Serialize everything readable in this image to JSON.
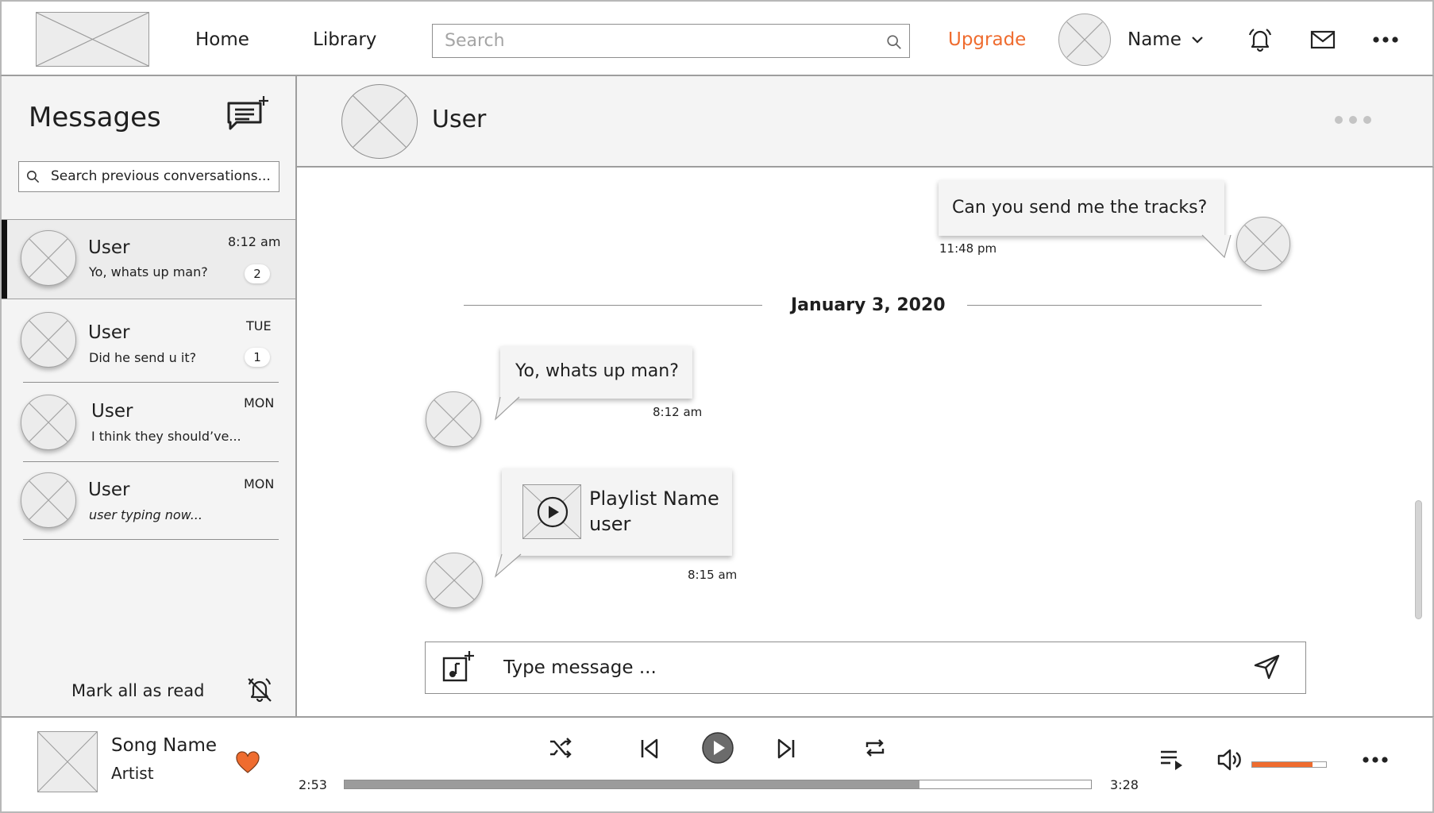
{
  "header": {
    "logo": "logo-placeholder",
    "nav": [
      {
        "label": "Home"
      },
      {
        "label": "Library"
      }
    ],
    "search": {
      "placeholder": "Search",
      "value": ""
    },
    "upgrade_label": "Upgrade",
    "user_name": "Name",
    "icons": [
      "search-icon",
      "chevron-down-icon",
      "bell-icon",
      "mail-icon",
      "more-icon"
    ]
  },
  "sidebar": {
    "title": "Messages",
    "search_placeholder": "Search previous conversations...",
    "conversations": [
      {
        "name": "User",
        "preview": "Yo, whats up man?",
        "time": "8:12 am",
        "badge": "2",
        "active": true
      },
      {
        "name": "User",
        "preview": "Did he send u it?",
        "time": "TUE",
        "badge": "1"
      },
      {
        "name": "User",
        "preview": "I think they should’ve...",
        "time": "MON"
      },
      {
        "name": "User",
        "preview": "user typing now...",
        "time": "MON"
      }
    ],
    "mark_all_read_label": "Mark all as read",
    "icons": [
      "new-message-icon",
      "search-icon",
      "bell-off-icon"
    ]
  },
  "chat": {
    "header_user": "User",
    "messages": [
      {
        "text": "Can you send me the tracks?",
        "time": "11:48 pm",
        "side": "outgoing"
      },
      {
        "date_separator": "January 3, 2020"
      },
      {
        "text": "Yo, whats up man?",
        "time": "8:12 am",
        "side": "incoming"
      },
      {
        "type": "playlist",
        "playlist_name": "Playlist Name",
        "playlist_owner": "user",
        "time": "8:15 am",
        "side": "incoming"
      }
    ],
    "composer_placeholder": "Type message ...",
    "icons": [
      "more-dots-icon",
      "add-music-icon",
      "send-icon",
      "play-icon"
    ]
  },
  "player": {
    "song_name": "Song Name",
    "artist": "Artist",
    "liked": true,
    "elapsed": "2:53",
    "duration": "3:28",
    "progress": 0.77,
    "volume": 0.82,
    "icons": [
      "heart-icon",
      "shuffle-icon",
      "previous-icon",
      "play-icon",
      "next-icon",
      "repeat-icon",
      "queue-icon",
      "volume-icon",
      "more-icon"
    ]
  },
  "colors": {
    "accent": "#ef6c2f",
    "panel_bg": "#f4f4f4",
    "border": "#8e8e8e",
    "placeholder_fill": "#ececec",
    "progress_fill": "#9b9b9b",
    "active_bar": "#111111"
  }
}
